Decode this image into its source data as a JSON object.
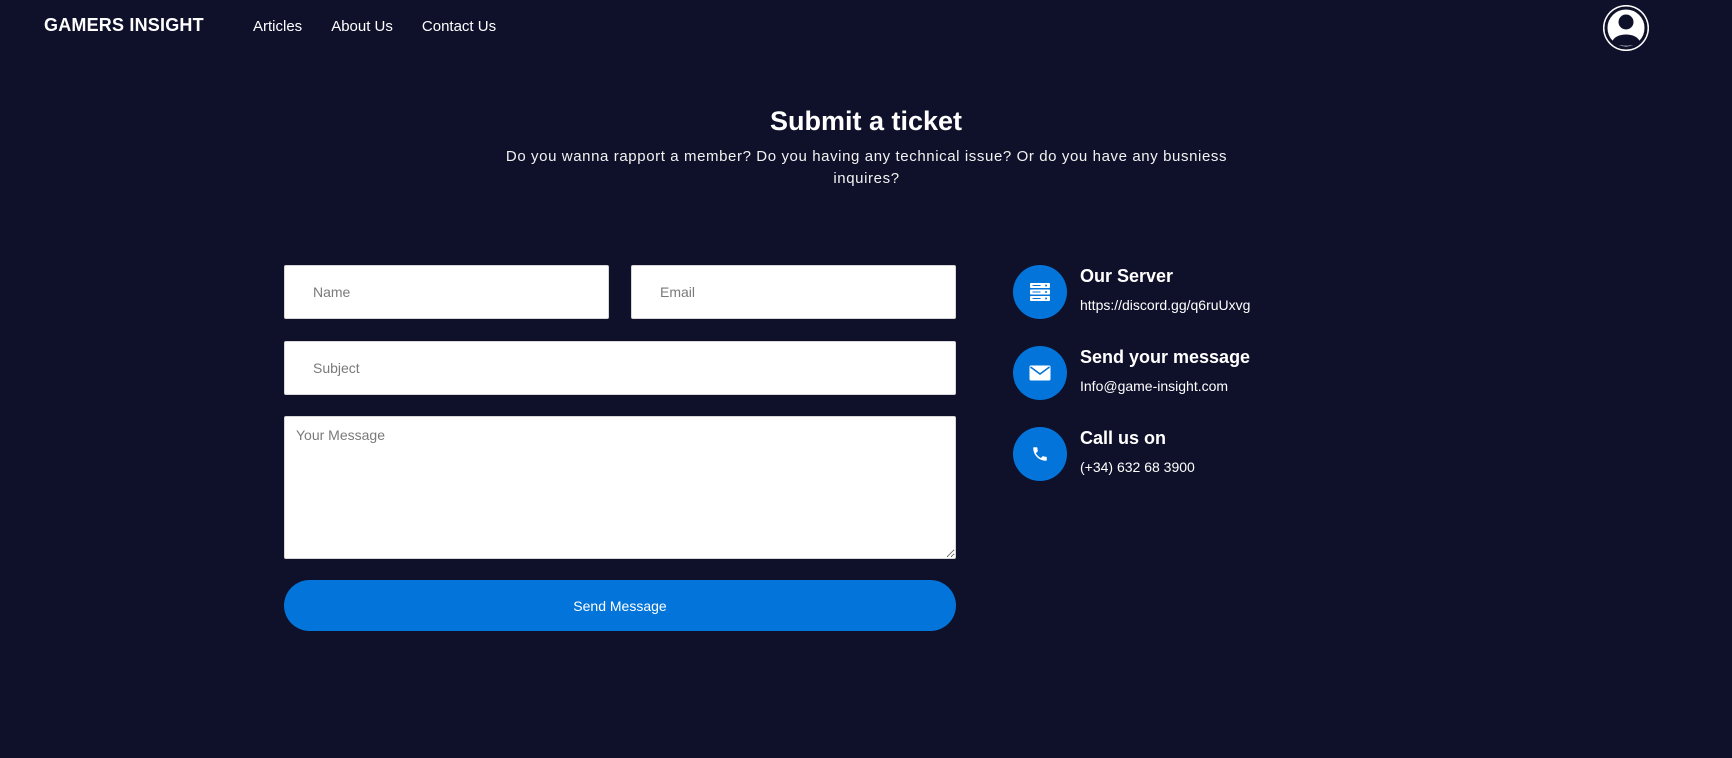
{
  "header": {
    "brand": "GAMERS INSIGHT",
    "nav": [
      {
        "label": "Articles"
      },
      {
        "label": "About Us"
      },
      {
        "label": "Contact Us"
      }
    ],
    "avatar_icon": "user-avatar-icon"
  },
  "hero": {
    "title": "Submit a ticket",
    "subtitle": "Do you wanna rapport a member? Do you having any technical issue? Or do you have any busniess inquires?"
  },
  "form": {
    "name_placeholder": "Name",
    "email_placeholder": "Email",
    "subject_placeholder": "Subject",
    "message_placeholder": "Your Message",
    "submit_label": "Send Message"
  },
  "contact": {
    "items": [
      {
        "title": "Our Server",
        "value": "https://discord.gg/q6ruUxvg",
        "icon": "server-icon"
      },
      {
        "title": "Send your message",
        "value": "Info@game-insight.com",
        "icon": "envelope-icon"
      },
      {
        "title": "Call us on",
        "value": "(+34) 632 68 3900",
        "icon": "phone-icon"
      }
    ]
  },
  "colors": {
    "background": "#0f102a",
    "accent": "#0374d9",
    "text": "#ffffff"
  }
}
